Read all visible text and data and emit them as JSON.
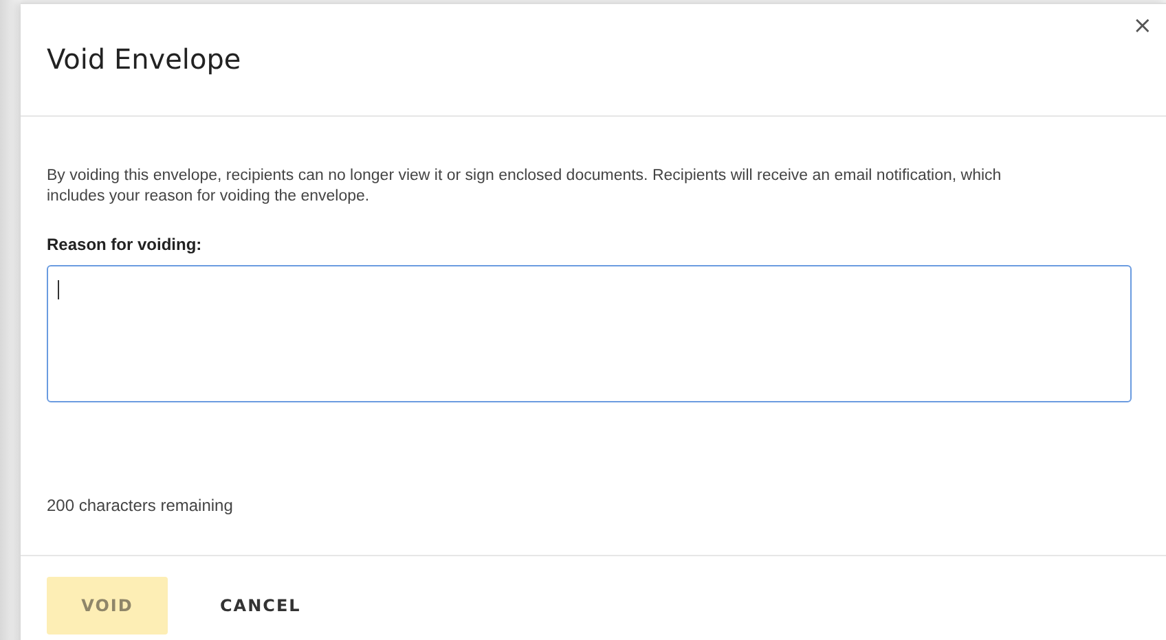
{
  "dialog": {
    "title": "Void Envelope",
    "close": "×",
    "description": "By voiding this envelope, recipients can no longer view it or sign enclosed documents. Recipients will receive an email notification, which includes your reason for voiding the envelope.",
    "reason_field": {
      "label": "Reason for voiding:",
      "focused": true
    },
    "counter": "200 characters remaining",
    "buttons": [
      {
        "label": "VOID",
        "kind": "primary",
        "disabled": true
      },
      {
        "label": "CANCEL",
        "kind": "secondary",
        "disabled": false
      }
    ]
  }
}
